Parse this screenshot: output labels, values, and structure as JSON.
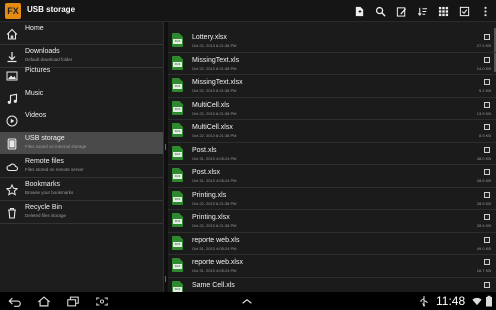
{
  "app": {
    "title": "USB storage",
    "logo_text": "FX"
  },
  "actionbar": {
    "actions": [
      {
        "name": "new-file-icon"
      },
      {
        "name": "search-icon"
      },
      {
        "name": "edit-icon"
      },
      {
        "name": "sort-icon"
      },
      {
        "name": "grid-view-icon"
      },
      {
        "name": "select-all-icon"
      },
      {
        "name": "overflow-menu-icon"
      }
    ]
  },
  "sidebar": {
    "items": [
      {
        "title": "Home",
        "subtitle": "",
        "icon": "home-icon",
        "active": false
      },
      {
        "title": "Downloads",
        "subtitle": "Default download folder",
        "icon": "download-icon",
        "active": false
      },
      {
        "title": "Pictures",
        "subtitle": "",
        "icon": "pictures-icon",
        "active": false
      },
      {
        "title": "Music",
        "subtitle": "",
        "icon": "music-icon",
        "active": false
      },
      {
        "title": "Videos",
        "subtitle": "",
        "icon": "videos-icon",
        "active": false
      },
      {
        "title": "USB storage",
        "subtitle": "Files saved on internal storage",
        "icon": "tablet-icon",
        "active": true
      },
      {
        "title": "Remote files",
        "subtitle": "Files stored on remote server",
        "icon": "cloud-icon",
        "active": false
      },
      {
        "title": "Bookmarks",
        "subtitle": "Browse your bookmarks",
        "icon": "star-icon",
        "active": false
      },
      {
        "title": "Recycle Bin",
        "subtitle": "Deleted files storage",
        "icon": "trash-icon",
        "active": false
      }
    ]
  },
  "files": [
    {
      "name": "Lottery.xlsx",
      "date": "Oct 22, 2013 6:21:38 PM",
      "size": "27.5 KB",
      "ext": "XLS"
    },
    {
      "name": "MissingText.xls",
      "date": "Oct 22, 2013 6:21:38 PM",
      "size": "14.0 KB",
      "ext": "XLS"
    },
    {
      "name": "MissingText.xlsx",
      "date": "Oct 22, 2013 6:21:38 PM",
      "size": "9.2 KB",
      "ext": "XLS"
    },
    {
      "name": "MultiCell.xls",
      "date": "Oct 22, 2013 6:21:38 PM",
      "size": "13.5 KB",
      "ext": "XLS"
    },
    {
      "name": "MultiCell.xlsx",
      "date": "Oct 22, 2013 6:21:38 PM",
      "size": "8.5 KB",
      "ext": "XLS"
    },
    {
      "name": "Post.xls",
      "date": "Oct 31, 2013 4:05:24 PM",
      "size": "48.0 KB",
      "ext": "XLS"
    },
    {
      "name": "Post.xlsx",
      "date": "Oct 31, 2013 4:05:24 PM",
      "size": "28.6 KB",
      "ext": "XLS"
    },
    {
      "name": "Printing.xls",
      "date": "Oct 22, 2013 6:21:38 PM",
      "size": "28.5 KB",
      "ext": "XLS"
    },
    {
      "name": "Printing.xlsx",
      "date": "Oct 22, 2013 6:21:38 PM",
      "size": "28.6 KB",
      "ext": "XLS"
    },
    {
      "name": "reporte web.xls",
      "date": "Oct 31, 2013 4:05:24 PM",
      "size": "49.0 KB",
      "ext": "XLS"
    },
    {
      "name": "reporte web.xlsx",
      "date": "Oct 31, 2013 4:05:24 PM",
      "size": "16.7 KB",
      "ext": "XLS"
    },
    {
      "name": "Same Cell.xls",
      "date": "Oct 22, 2013 6:21:38 PM",
      "size": "28.0 KB",
      "ext": "XLS"
    }
  ],
  "systembar": {
    "time": "11:48"
  },
  "colors": {
    "accent": "#e58a12",
    "file_icon": "#2f8a2f",
    "active_item": "#4a4a4a"
  }
}
